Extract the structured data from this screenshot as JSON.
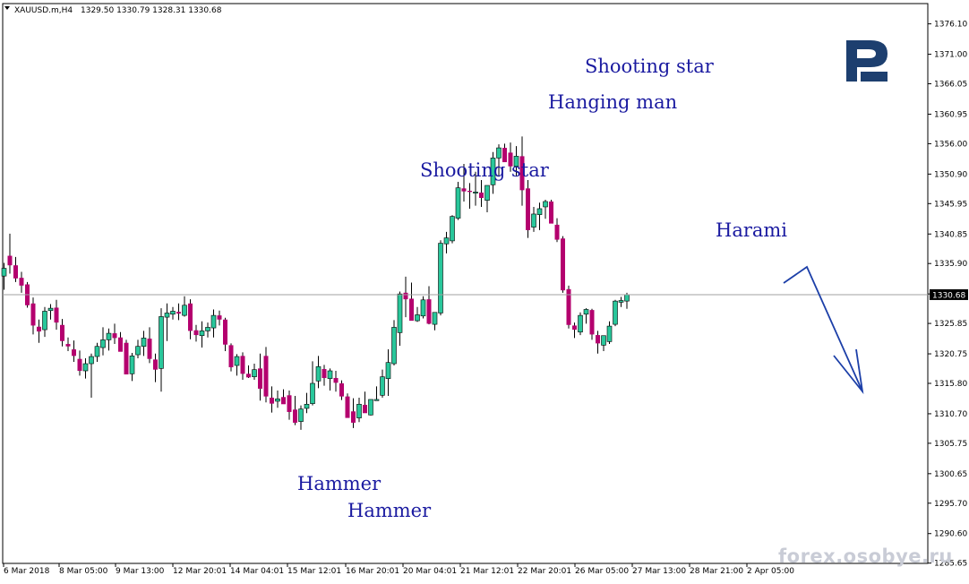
{
  "header": {
    "symbol_label": "XAUUSD.m,H4",
    "ohlc": "1329.50 1330.79 1328.31 1330.68"
  },
  "watermark": "forex.osobye.ru",
  "colors": {
    "bull": "#29c79b",
    "bear": "#b4006e",
    "annotation": "#1a1aa0",
    "arrow": "#1c3fa8",
    "logo": "#1d3f6f",
    "price_line": "#a0a0a0"
  },
  "chart_data": {
    "type": "candlestick",
    "title": "",
    "ylim": [
      1285.6,
      1379.5
    ],
    "y_ticks": [
      "1376.10",
      "1371.00",
      "1366.05",
      "1360.95",
      "1356.00",
      "1350.90",
      "1345.95",
      "1340.85",
      "1335.90",
      "1330.80",
      "1325.85",
      "1320.75",
      "1315.80",
      "1310.70",
      "1305.75",
      "1300.65",
      "1295.70",
      "1290.60",
      "1285.65"
    ],
    "x_ticks": [
      "6 Mar 2018",
      "8 Mar 05:00",
      "9 Mar 13:00",
      "12 Mar 20:01",
      "14 Mar 04:01",
      "15 Mar 12:01",
      "16 Mar 20:01",
      "20 Mar 04:01",
      "21 Mar 12:01",
      "22 Mar 20:01",
      "26 Mar 05:00",
      "27 Mar 13:00",
      "28 Mar 21:00",
      "2 Apr 05:00"
    ],
    "current_price": "1330.68",
    "grid": false,
    "candles": [
      [
        1333.8,
        1336.0,
        1331.5,
        1335.1
      ],
      [
        1337.2,
        1340.9,
        1334.2,
        1335.6
      ],
      [
        1335.6,
        1337.0,
        1332.8,
        1333.4
      ],
      [
        1333.5,
        1334.5,
        1331.0,
        1332.2
      ],
      [
        1332.4,
        1332.8,
        1328.5,
        1328.9
      ],
      [
        1329.2,
        1330.2,
        1324.0,
        1325.5
      ],
      [
        1325.3,
        1326.5,
        1322.6,
        1324.5
      ],
      [
        1324.8,
        1328.6,
        1323.6,
        1327.9
      ],
      [
        1328.0,
        1329.1,
        1326.5,
        1328.4
      ],
      [
        1328.5,
        1329.8,
        1324.8,
        1326.0
      ],
      [
        1325.6,
        1326.6,
        1322.0,
        1322.9
      ],
      [
        1322.4,
        1323.5,
        1321.2,
        1322.0
      ],
      [
        1321.5,
        1323.0,
        1319.4,
        1320.4
      ],
      [
        1319.9,
        1321.3,
        1317.1,
        1317.9
      ],
      [
        1317.9,
        1320.0,
        1316.6,
        1319.1
      ],
      [
        1319.1,
        1320.8,
        1313.4,
        1320.3
      ],
      [
        1320.3,
        1322.6,
        1319.4,
        1322.0
      ],
      [
        1321.8,
        1325.2,
        1320.5,
        1323.1
      ],
      [
        1323.1,
        1325.0,
        1321.3,
        1324.2
      ],
      [
        1324.2,
        1325.8,
        1322.4,
        1323.4
      ],
      [
        1323.5,
        1324.4,
        1321.3,
        1321.1
      ],
      [
        1322.6,
        1323.1,
        1317.6,
        1317.3
      ],
      [
        1317.4,
        1320.9,
        1316.2,
        1320.4
      ],
      [
        1320.6,
        1323.1,
        1320.0,
        1322.0
      ],
      [
        1322.0,
        1324.6,
        1320.4,
        1323.4
      ],
      [
        1323.3,
        1325.2,
        1319.2,
        1319.9
      ],
      [
        1319.8,
        1320.8,
        1316.0,
        1318.1
      ],
      [
        1318.3,
        1328.4,
        1314.4,
        1327.0
      ],
      [
        1326.9,
        1329.2,
        1322.9,
        1327.6
      ],
      [
        1327.4,
        1328.6,
        1326.5,
        1327.9
      ],
      [
        1327.8,
        1329.2,
        1326.4,
        1327.5
      ],
      [
        1327.2,
        1330.4,
        1327.0,
        1328.9
      ],
      [
        1329.2,
        1329.9,
        1323.2,
        1324.6
      ],
      [
        1324.7,
        1325.6,
        1322.8,
        1323.9
      ],
      [
        1323.8,
        1326.2,
        1321.8,
        1324.6
      ],
      [
        1324.6,
        1326.0,
        1323.5,
        1325.2
      ],
      [
        1325.1,
        1328.2,
        1323.5,
        1327.2
      ],
      [
        1327.2,
        1328.0,
        1325.5,
        1326.5
      ],
      [
        1326.5,
        1326.8,
        1321.2,
        1322.3
      ],
      [
        1322.2,
        1322.5,
        1317.8,
        1318.5
      ],
      [
        1318.8,
        1320.7,
        1317.1,
        1320.3
      ],
      [
        1320.4,
        1321.0,
        1316.4,
        1317.4
      ],
      [
        1317.4,
        1318.8,
        1316.7,
        1316.8
      ],
      [
        1316.9,
        1319.1,
        1316.4,
        1318.1
      ],
      [
        1318.3,
        1320.8,
        1312.9,
        1314.9
      ],
      [
        1320.4,
        1321.9,
        1312.6,
        1313.6
      ],
      [
        1313.4,
        1315.3,
        1310.9,
        1312.4
      ],
      [
        1312.8,
        1314.6,
        1311.7,
        1313.2
      ],
      [
        1313.5,
        1314.8,
        1312.4,
        1312.3
      ],
      [
        1313.8,
        1314.6,
        1309.7,
        1311.0
      ],
      [
        1311.4,
        1313.7,
        1308.8,
        1309.2
      ],
      [
        1309.4,
        1312.1,
        1308.0,
        1311.5
      ],
      [
        1311.6,
        1314.2,
        1310.8,
        1312.3
      ],
      [
        1312.4,
        1319.5,
        1312.1,
        1315.8
      ],
      [
        1316.2,
        1320.4,
        1315.0,
        1318.6
      ],
      [
        1318.2,
        1318.9,
        1315.4,
        1316.7
      ],
      [
        1316.6,
        1318.3,
        1314.6,
        1317.9
      ],
      [
        1316.7,
        1317.9,
        1314.4,
        1315.9
      ],
      [
        1315.8,
        1316.3,
        1313.0,
        1313.6
      ],
      [
        1313.6,
        1314.1,
        1310.4,
        1310.0
      ],
      [
        1311.1,
        1313.3,
        1308.3,
        1309.2
      ],
      [
        1310.0,
        1313.4,
        1309.3,
        1312.3
      ],
      [
        1312.2,
        1314.4,
        1311.5,
        1310.8
      ],
      [
        1310.5,
        1313.1,
        1310.4,
        1313.1
      ],
      [
        1312.9,
        1315.3,
        1312.9,
        1313.1
      ],
      [
        1313.8,
        1318.1,
        1313.4,
        1316.9
      ],
      [
        1316.6,
        1321.5,
        1313.7,
        1319.3
      ],
      [
        1319.1,
        1326.4,
        1318.8,
        1325.2
      ],
      [
        1324.3,
        1331.2,
        1322.1,
        1330.8
      ],
      [
        1331.0,
        1333.7,
        1326.9,
        1329.9
      ],
      [
        1330.0,
        1332.7,
        1328.6,
        1326.3
      ],
      [
        1326.3,
        1328.6,
        1326.1,
        1327.3
      ],
      [
        1327.1,
        1330.4,
        1326.7,
        1329.8
      ],
      [
        1329.9,
        1332.1,
        1325.7,
        1325.8
      ],
      [
        1325.7,
        1327.6,
        1324.7,
        1327.7
      ],
      [
        1327.6,
        1339.8,
        1327.2,
        1339.3
      ],
      [
        1339.2,
        1341.2,
        1337.6,
        1340.2
      ],
      [
        1339.7,
        1344.0,
        1339.3,
        1343.8
      ],
      [
        1343.5,
        1349.6,
        1343.2,
        1348.6
      ],
      [
        1348.5,
        1352.6,
        1346.3,
        1348.0
      ],
      [
        1348.1,
        1349.4,
        1345.1,
        1347.9
      ],
      [
        1347.7,
        1351.3,
        1345.6,
        1347.9
      ],
      [
        1347.8,
        1349.9,
        1345.4,
        1346.9
      ],
      [
        1346.5,
        1348.8,
        1344.5,
        1349.0
      ],
      [
        1349.1,
        1354.6,
        1347.6,
        1353.6
      ],
      [
        1353.6,
        1355.9,
        1350.5,
        1355.3
      ],
      [
        1355.3,
        1356.0,
        1353.1,
        1352.9
      ],
      [
        1354.5,
        1356.2,
        1351.3,
        1352.2
      ],
      [
        1352.2,
        1355.6,
        1350.6,
        1353.9
      ],
      [
        1353.9,
        1357.2,
        1345.6,
        1348.2
      ],
      [
        1348.5,
        1349.9,
        1340.2,
        1341.5
      ],
      [
        1342.0,
        1345.4,
        1341.2,
        1344.2
      ],
      [
        1344.1,
        1346.1,
        1341.5,
        1345.1
      ],
      [
        1345.4,
        1346.6,
        1343.4,
        1346.3
      ],
      [
        1346.3,
        1346.6,
        1342.9,
        1342.6
      ],
      [
        1342.4,
        1343.5,
        1339.5,
        1339.9
      ],
      [
        1340.1,
        1340.5,
        1331.0,
        1331.4
      ],
      [
        1331.6,
        1332.2,
        1325.0,
        1325.6
      ],
      [
        1325.5,
        1326.0,
        1323.4,
        1324.8
      ],
      [
        1324.4,
        1327.7,
        1323.9,
        1327.2
      ],
      [
        1327.4,
        1328.4,
        1325.8,
        1328.2
      ],
      [
        1328.1,
        1328.3,
        1323.1,
        1324.0
      ],
      [
        1323.9,
        1324.6,
        1320.8,
        1322.5
      ],
      [
        1322.2,
        1323.6,
        1321.2,
        1323.8
      ],
      [
        1322.8,
        1326.2,
        1322.4,
        1325.4
      ],
      [
        1325.7,
        1329.8,
        1325.4,
        1329.6
      ],
      [
        1329.4,
        1330.3,
        1328.6,
        1329.7
      ],
      [
        1329.6,
        1331.0,
        1328.3,
        1330.7
      ]
    ],
    "annotations": [
      {
        "text": "Shooting star"
      },
      {
        "text": "Hanging man"
      },
      {
        "text": "Shooting star"
      },
      {
        "text": "Harami"
      },
      {
        "text": "Hammer"
      },
      {
        "text": "Hammer"
      }
    ]
  }
}
